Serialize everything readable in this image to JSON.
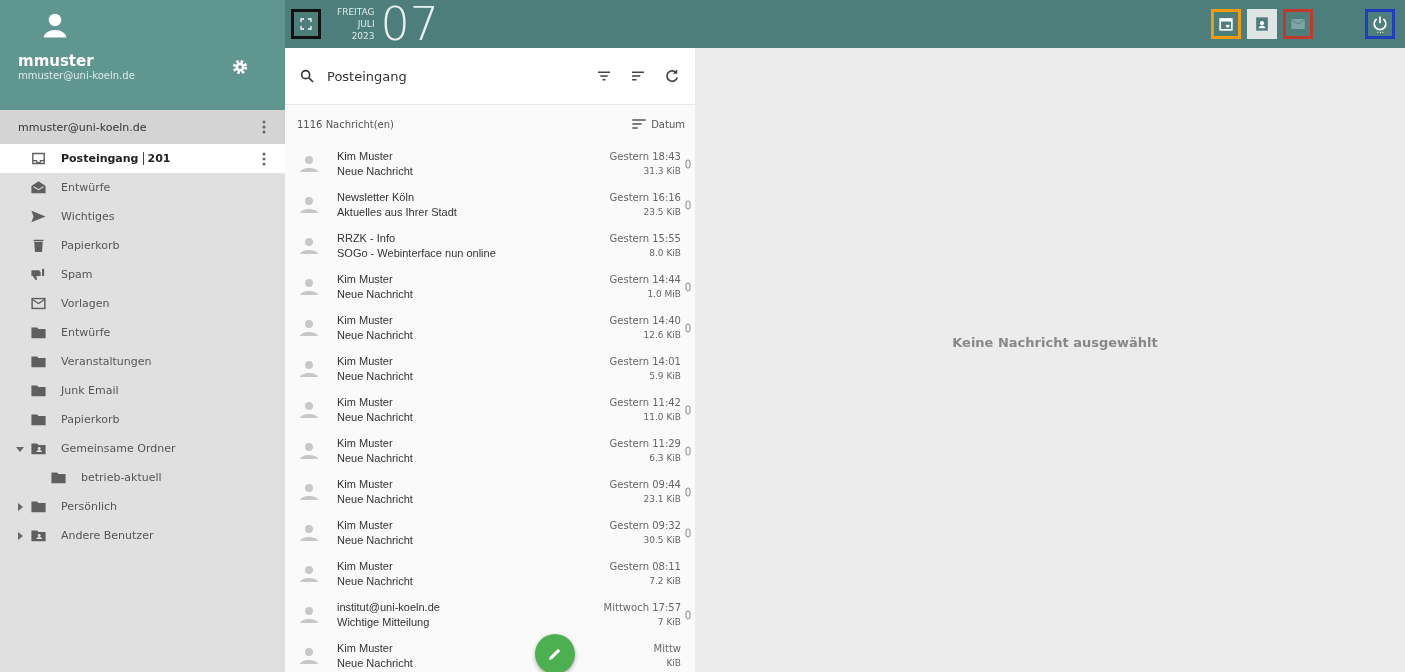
{
  "user": {
    "name": "mmuster",
    "email": "mmuster@uni-koeln.de"
  },
  "account": {
    "label": "mmuster@uni-koeln.de"
  },
  "folders": [
    {
      "label": "Posteingang",
      "count": "201",
      "kind": "inbox",
      "selected": true
    },
    {
      "label": "Entwürfe",
      "kind": "drafts",
      "selected": false
    },
    {
      "label": "Wichtiges",
      "kind": "send",
      "selected": false
    },
    {
      "label": "Papierkorb",
      "kind": "trash",
      "selected": false
    },
    {
      "label": "Spam",
      "kind": "spam",
      "selected": false
    },
    {
      "label": "Vorlagen",
      "kind": "mail",
      "selected": false
    },
    {
      "label": "Entwürfe",
      "kind": "folder",
      "selected": false
    },
    {
      "label": "Veranstaltungen",
      "kind": "folder",
      "selected": false
    },
    {
      "label": "Junk Email",
      "kind": "folder",
      "selected": false
    },
    {
      "label": "Papierkorb",
      "kind": "folder",
      "selected": false
    },
    {
      "label": "Gemeinsame Ordner",
      "kind": "shared",
      "selected": false,
      "expanded": true,
      "children": [
        {
          "label": "betrieb-aktuell",
          "kind": "folder",
          "selected": false
        }
      ]
    },
    {
      "label": "Persönlich",
      "kind": "folder",
      "selected": false,
      "expanded": false
    },
    {
      "label": "Andere Benutzer",
      "kind": "shared",
      "selected": false,
      "expanded": false
    }
  ],
  "date": {
    "weekday": "FREITAG",
    "month": "JULI",
    "year": "2023",
    "day": "07"
  },
  "top_buttons": [
    {
      "kind": "calendar",
      "color": "#f39c12",
      "selected": false
    },
    {
      "kind": "contacts",
      "color": "#dfe5e5",
      "selected": true
    },
    {
      "kind": "mail",
      "color": "#c0392b",
      "selected": false
    },
    {
      "kind": "power",
      "color": "#1f3fbf",
      "selected": false
    }
  ],
  "fullscreen_button": {
    "color": "#111111"
  },
  "list": {
    "title": "Posteingang",
    "count": "1116 Nachricht(en)",
    "sort": "Datum"
  },
  "messages": [
    {
      "sender": "Kim Muster",
      "subject": "Neue Nachricht",
      "time": "Gestern 18:43",
      "size": "31.3 KiB",
      "attachment": true
    },
    {
      "sender": "Newsletter Köln",
      "subject": "Aktuelles aus Ihrer Stadt",
      "time": "Gestern 16:16",
      "size": "23.5 KiB",
      "attachment": true
    },
    {
      "sender": "RRZK - Info",
      "subject": "SOGo - Webinterface nun online",
      "time": "Gestern 15:55",
      "size": "8.0 KiB",
      "attachment": false
    },
    {
      "sender": "Kim Muster",
      "subject": "Neue Nachricht",
      "time": "Gestern 14:44",
      "size": "1.0 MiB",
      "attachment": true
    },
    {
      "sender": "Kim Muster",
      "subject": "Neue Nachricht",
      "time": "Gestern 14:40",
      "size": "12.6 KiB",
      "attachment": true
    },
    {
      "sender": "Kim Muster",
      "subject": "Neue Nachricht",
      "time": "Gestern 14:01",
      "size": "5.9 KiB",
      "attachment": false
    },
    {
      "sender": "Kim Muster",
      "subject": "Neue Nachricht",
      "time": "Gestern 11:42",
      "size": "11.0 KiB",
      "attachment": true
    },
    {
      "sender": "Kim Muster",
      "subject": "Neue Nachricht",
      "time": "Gestern 11:29",
      "size": "6.3 KiB",
      "attachment": true
    },
    {
      "sender": "Kim Muster",
      "subject": "Neue Nachricht",
      "time": "Gestern 09:44",
      "size": "23.1 KiB",
      "attachment": true
    },
    {
      "sender": "Kim Muster",
      "subject": "Neue Nachricht",
      "time": "Gestern 09:32",
      "size": "30.5 KiB",
      "attachment": true
    },
    {
      "sender": "Kim Muster",
      "subject": "Neue Nachricht",
      "time": "Gestern 08:11",
      "size": "7.2 KiB",
      "attachment": false
    },
    {
      "sender": "institut@uni-koeln.de",
      "subject": "Wichtige Mitteilung",
      "time": "Mittwoch 17:57",
      "size": "7 KiB",
      "attachment": true
    },
    {
      "sender": "Kim Muster",
      "subject": "Neue Nachricht",
      "time": "Mittw",
      "size": "KiB",
      "attachment": false
    }
  ],
  "empty_message": "Keine Nachricht ausgewählt"
}
